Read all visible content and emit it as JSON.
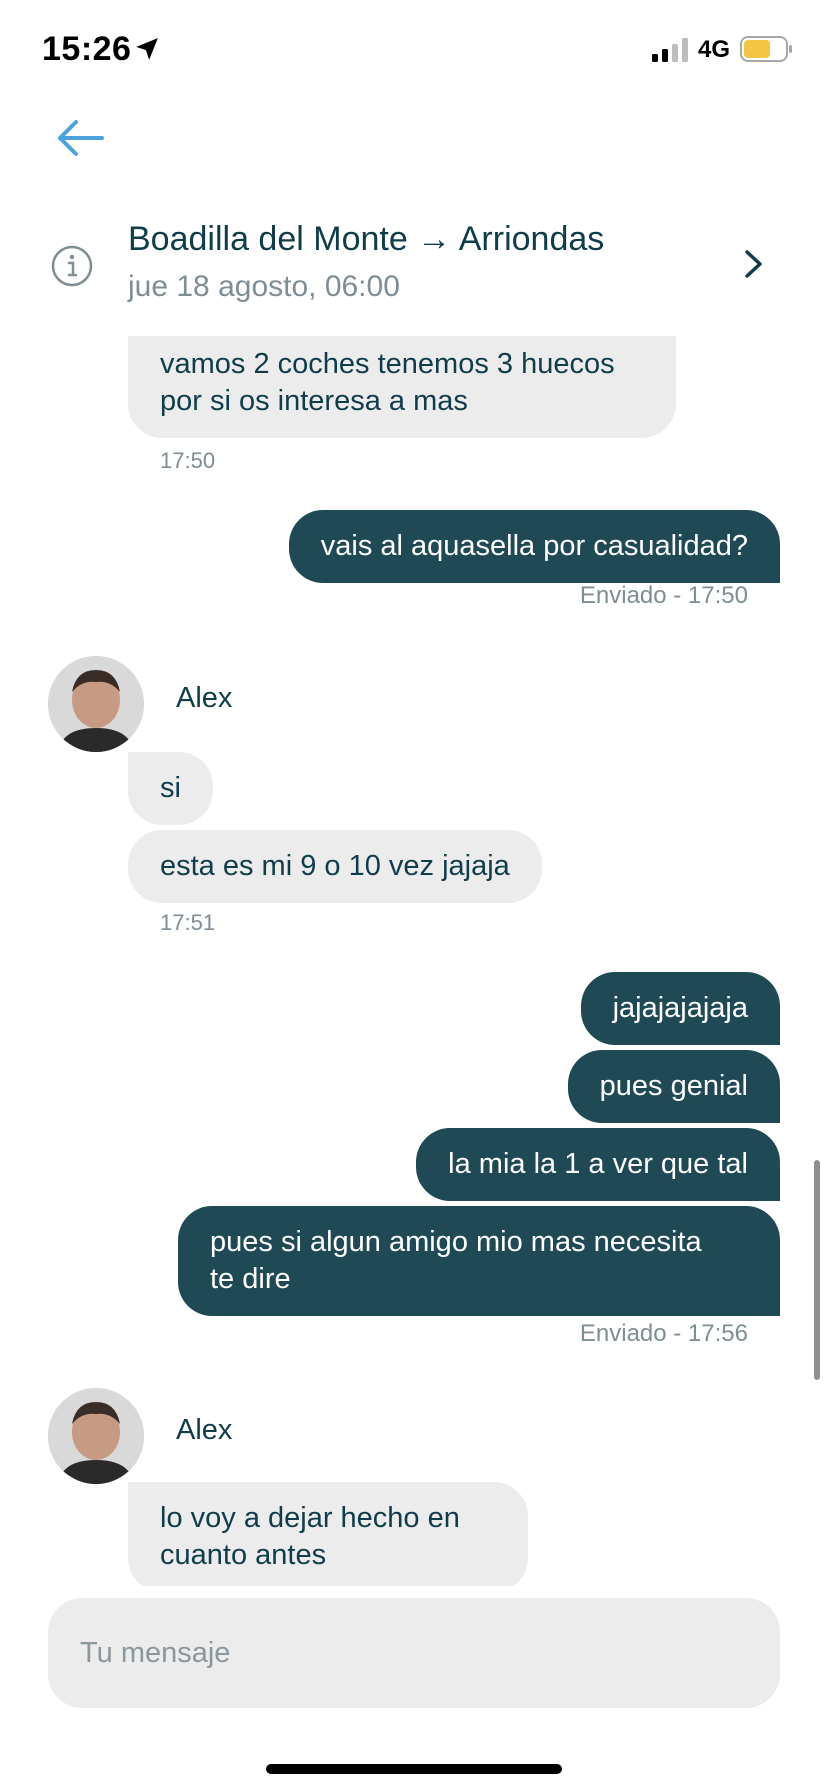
{
  "status": {
    "time": "15:26",
    "network": "4G",
    "battery_color": "#f4c542"
  },
  "trip": {
    "title": "Boadilla del Monte → Arriondas",
    "date": "jue 18 agosto, 06:00"
  },
  "colors": {
    "accent": "#4aa3df",
    "outgoing_bubble": "#1f4a55",
    "incoming_bubble": "#ececec",
    "text_dark": "#0f3d4a",
    "muted": "#7f8d95"
  },
  "messages": [
    {
      "dir": "in",
      "text": "vamos 2 coches tenemos 3 huecos\npor si os interesa a mas"
    },
    {
      "time": "17:50"
    },
    {
      "dir": "out",
      "text": "vais al aquasella por casualidad?"
    },
    {
      "status": "Enviado - 17:50"
    },
    {
      "sender": "Alex"
    },
    {
      "dir": "in",
      "text": "si"
    },
    {
      "dir": "in",
      "text": "esta es mi 9 o 10 vez jajaja"
    },
    {
      "time": "17:51"
    },
    {
      "dir": "out",
      "text": "jajajajajaja"
    },
    {
      "dir": "out",
      "text": "pues genial"
    },
    {
      "dir": "out",
      "text": "la mia la 1 a ver que tal"
    },
    {
      "dir": "out",
      "text": "pues si algun amigo mio mas necesita\nte dire"
    },
    {
      "status": "Enviado - 17:56"
    },
    {
      "sender": "Alex"
    },
    {
      "dir": "in",
      "text": "lo voy a dejar hecho en\ncuanto antes"
    }
  ],
  "m": {
    "in1": "vamos 2 coches tenemos 3 huecos\npor si os interesa a mas",
    "t1": "17:50",
    "out1": "vais al aquasella por casualidad?",
    "s1": "Enviado - 17:50",
    "sender1": "Alex",
    "in2": "si",
    "in3": "esta es mi 9 o 10 vez jajaja",
    "t2": "17:51",
    "out2": "jajajajajaja",
    "out3": "pues genial",
    "out4": "la mia la 1 a ver que tal",
    "out5": "pues si algun amigo mio mas necesita\nte dire",
    "s2": "Enviado - 17:56",
    "sender2": "Alex",
    "in4": "lo voy a dejar hecho en\ncuanto antes"
  },
  "composer": {
    "placeholder": "Tu mensaje"
  },
  "icons": [
    "location-arrow-icon",
    "signal-icon",
    "battery-icon",
    "back-arrow-icon",
    "info-icon",
    "chevron-right-icon"
  ]
}
